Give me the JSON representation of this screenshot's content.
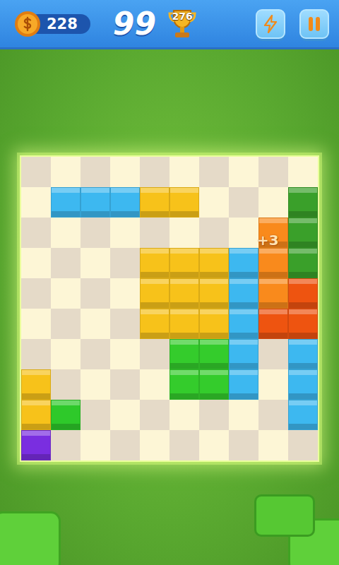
{
  "hud": {
    "coins": "228",
    "score": "99",
    "best": "276"
  },
  "popup": {
    "text": "+3"
  },
  "board": {
    "rows": [
      [
        "",
        "",
        "",
        "",
        "",
        "",
        "",
        "",
        "",
        ""
      ],
      [
        "",
        "#3db8f0",
        "#3db8f0",
        "#3db8f0",
        "#f7c21a",
        "#f7c21a",
        "",
        "",
        "",
        "#3aa02a"
      ],
      [
        "",
        "",
        "",
        "",
        "",
        "",
        "",
        "",
        "#f98a1c",
        "#3aa02a"
      ],
      [
        "",
        "",
        "",
        "",
        "#f7c21a",
        "#f7c21a",
        "#f7c21a",
        "#3db8f0",
        "#f98a1c",
        "#3aa02a"
      ],
      [
        "",
        "",
        "",
        "",
        "#f7c21a",
        "#f7c21a",
        "#f7c21a",
        "#3db8f0",
        "#f98a1c",
        "#ee5410"
      ],
      [
        "",
        "",
        "",
        "",
        "#f7c21a",
        "#f7c21a",
        "#f7c21a",
        "#3db8f0",
        "#ee5410",
        "#ee5410"
      ],
      [
        "",
        "",
        "",
        "",
        "",
        "#34cc2c",
        "#34cc2c",
        "#3db8f0",
        "",
        "#3db8f0"
      ],
      [
        "#f7c21a",
        "",
        "",
        "",
        "",
        "#34cc2c",
        "#34cc2c",
        "#3db8f0",
        "",
        "#3db8f0"
      ],
      [
        "#f7c21a",
        "#2ec92a",
        "",
        "",
        "",
        "",
        "",
        "",
        "",
        "#3db8f0"
      ],
      [
        "#7a2ee0",
        "",
        "",
        "",
        "",
        "",
        "",
        "",
        "",
        ""
      ]
    ]
  }
}
